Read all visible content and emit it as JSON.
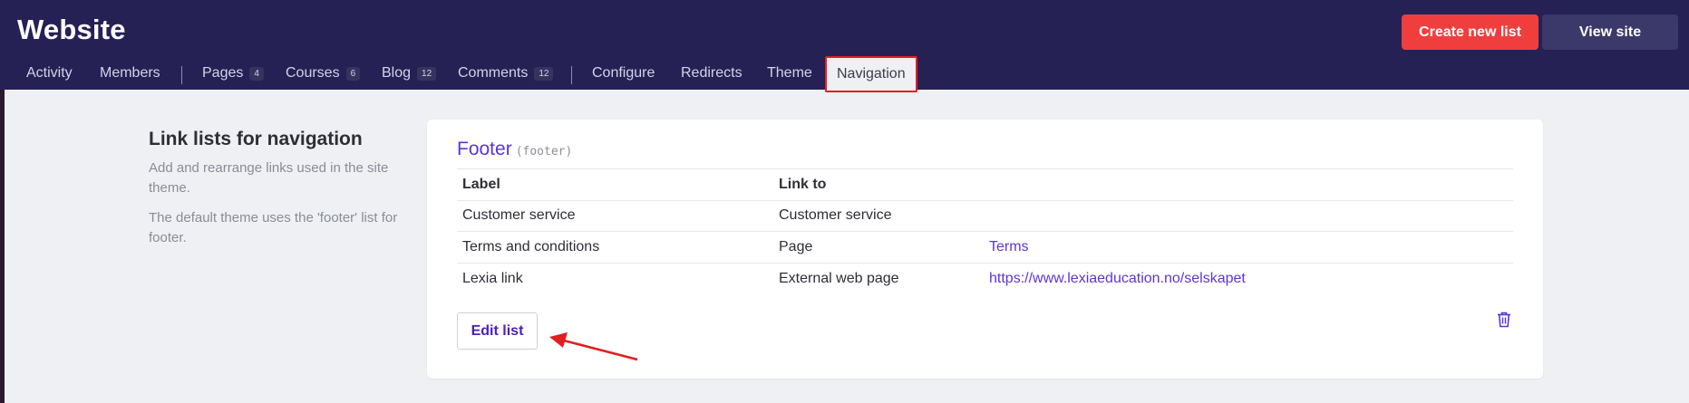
{
  "header": {
    "title": "Website",
    "create_button": "Create new list",
    "view_button": "View site"
  },
  "nav": {
    "activity": "Activity",
    "members": "Members",
    "pages": "Pages",
    "pages_count": "4",
    "courses": "Courses",
    "courses_count": "6",
    "blog": "Blog",
    "blog_count": "12",
    "comments": "Comments",
    "comments_count": "12",
    "configure": "Configure",
    "redirects": "Redirects",
    "theme": "Theme",
    "navigation": "Navigation"
  },
  "sidebar": {
    "title": "Link lists for navigation",
    "description": "Add and rearrange links used in the site theme.",
    "note": "The default theme uses the 'footer' list for footer."
  },
  "card": {
    "title": "Footer",
    "code": "(footer)",
    "columns": [
      "Label",
      "Link to",
      ""
    ],
    "rows": [
      {
        "label": "Customer service",
        "link_to": "Customer service",
        "target": ""
      },
      {
        "label": "Terms and conditions",
        "link_to": "Page",
        "target": "Terms"
      },
      {
        "label": "Lexia link",
        "link_to": "External web page",
        "target": "https://www.lexiaeducation.no/selskapet"
      }
    ],
    "edit_button": "Edit list"
  },
  "icons": {
    "delete": "trash-icon",
    "annotation": "red-arrow-icon"
  },
  "colors": {
    "header_bg": "#252155",
    "accent": "#5b35d5",
    "danger": "#f03e3e",
    "highlight": "#e01f1f"
  }
}
